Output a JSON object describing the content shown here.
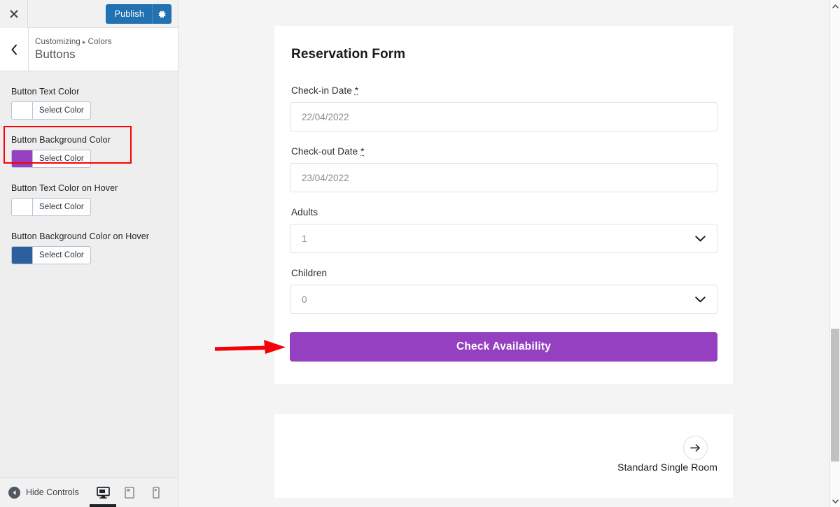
{
  "customizer": {
    "close_icon": "close-icon",
    "publish": {
      "label": "Publish",
      "icon": "gear-icon",
      "color": "#2271b1"
    },
    "back_icon": "chevron-left-icon",
    "breadcrumb": {
      "root": "Customizing",
      "separator": "▸",
      "section": "Colors"
    },
    "panel_title": "Buttons",
    "controls": [
      {
        "label": "Button Text Color",
        "swatch": "#ffffff",
        "button_label": "Select Color"
      },
      {
        "label": "Button Background Color",
        "swatch": "#9440c0",
        "button_label": "Select Color"
      },
      {
        "label": "Button Text Color on Hover",
        "swatch": "#ffffff",
        "button_label": "Select Color"
      },
      {
        "label": "Button Background Color on Hover",
        "swatch": "#2c5f9e",
        "button_label": "Select Color"
      }
    ],
    "highlight_color": "#fb0007",
    "footer": {
      "hide_controls_label": "Hide Controls",
      "hide_icon": "arrow-left-circle-icon",
      "devices": [
        {
          "name": "desktop",
          "icon": "desktop-icon",
          "active": true
        },
        {
          "name": "tablet",
          "icon": "tablet-icon",
          "active": false
        },
        {
          "name": "mobile",
          "icon": "mobile-icon",
          "active": false
        }
      ]
    }
  },
  "preview": {
    "form": {
      "title": "Reservation Form",
      "fields": [
        {
          "label": "Check-in Date",
          "required": "*",
          "value": "22/04/2022",
          "type": "date"
        },
        {
          "label": "Check-out Date",
          "required": "*",
          "value": "23/04/2022",
          "type": "date"
        },
        {
          "label": "Adults",
          "required": "",
          "value": "1",
          "type": "select"
        },
        {
          "label": "Children",
          "required": "",
          "value": "0",
          "type": "select"
        }
      ],
      "submit": {
        "label": "Check Availability",
        "bg": "#9440c0",
        "text_color": "#ffffff"
      }
    },
    "room_card": {
      "arrow_icon": "arrow-right-icon",
      "name": "Standard Single Room"
    }
  },
  "annotation": {
    "type": "arrow",
    "color": "#f40009",
    "points_to": "Check Availability"
  },
  "scrollbar": {
    "up_icon": "chevron-up-icon",
    "down_icon": "chevron-down-icon"
  }
}
